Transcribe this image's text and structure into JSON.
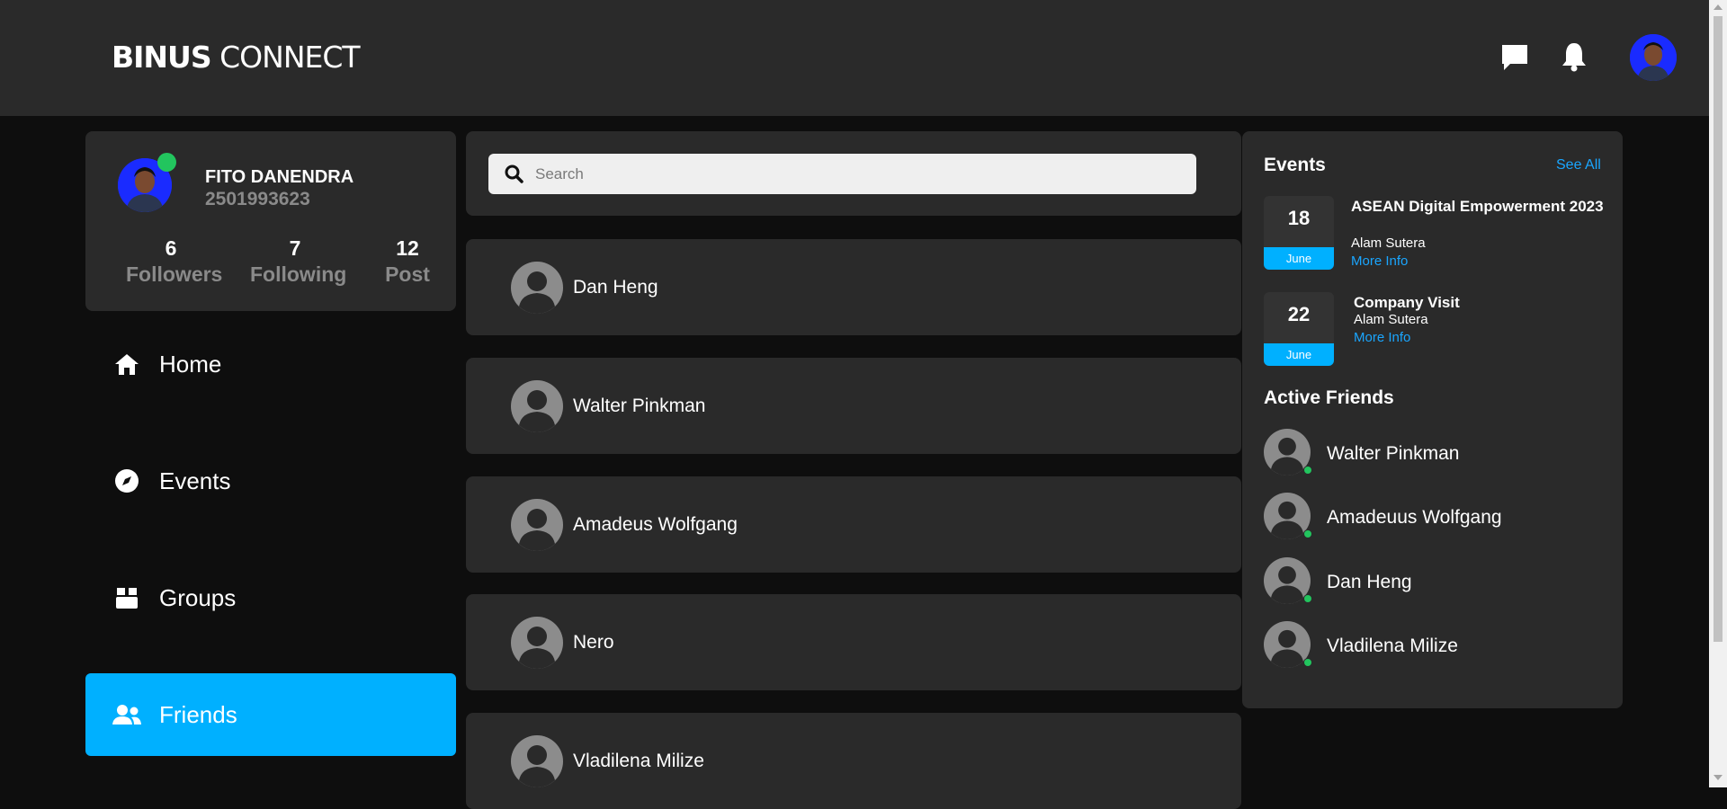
{
  "header": {
    "brand_bold": "BINUS",
    "brand_light": " CONNECT",
    "icons": [
      "chat-icon",
      "bell-icon",
      "profile-avatar"
    ]
  },
  "profile": {
    "name": "FITO DANENDRA",
    "id": "2501993623",
    "online": true,
    "stats": [
      {
        "num": "6",
        "label": "Followers"
      },
      {
        "num": "7",
        "label": "Following"
      },
      {
        "num": "12",
        "label": "Post"
      }
    ]
  },
  "nav": [
    {
      "label": "Home",
      "icon": "home-icon",
      "active": false
    },
    {
      "label": "Events",
      "icon": "compass-icon",
      "active": false
    },
    {
      "label": "Groups",
      "icon": "box-icon",
      "active": false
    },
    {
      "label": "Friends",
      "icon": "users-icon",
      "active": true
    }
  ],
  "search": {
    "placeholder": "Search"
  },
  "friends": [
    {
      "name": "Dan Heng"
    },
    {
      "name": "Walter Pinkman"
    },
    {
      "name": "Amadeus Wolfgang"
    },
    {
      "name": "Nero"
    },
    {
      "name": "Vladilena Milize"
    }
  ],
  "events": {
    "title": "Events",
    "see_all": "See All",
    "items": [
      {
        "day": "18",
        "month": "June",
        "title": "ASEAN Digital Empowerment 2023",
        "location": "Alam Sutera",
        "more": "More Info"
      },
      {
        "day": "22",
        "month": "June",
        "title": "Company Visit",
        "location": "Alam Sutera",
        "more": "More Info"
      }
    ]
  },
  "active_friends": {
    "title": "Active Friends",
    "items": [
      {
        "name": "Walter Pinkman"
      },
      {
        "name": "Amadeuus Wolfgang"
      },
      {
        "name": "Dan Heng"
      },
      {
        "name": "Vladilena Milize"
      }
    ]
  },
  "colors": {
    "accent": "#00b0ff",
    "card": "#2a2a2a",
    "online": "#22c55e",
    "link": "#1aa6ff"
  }
}
